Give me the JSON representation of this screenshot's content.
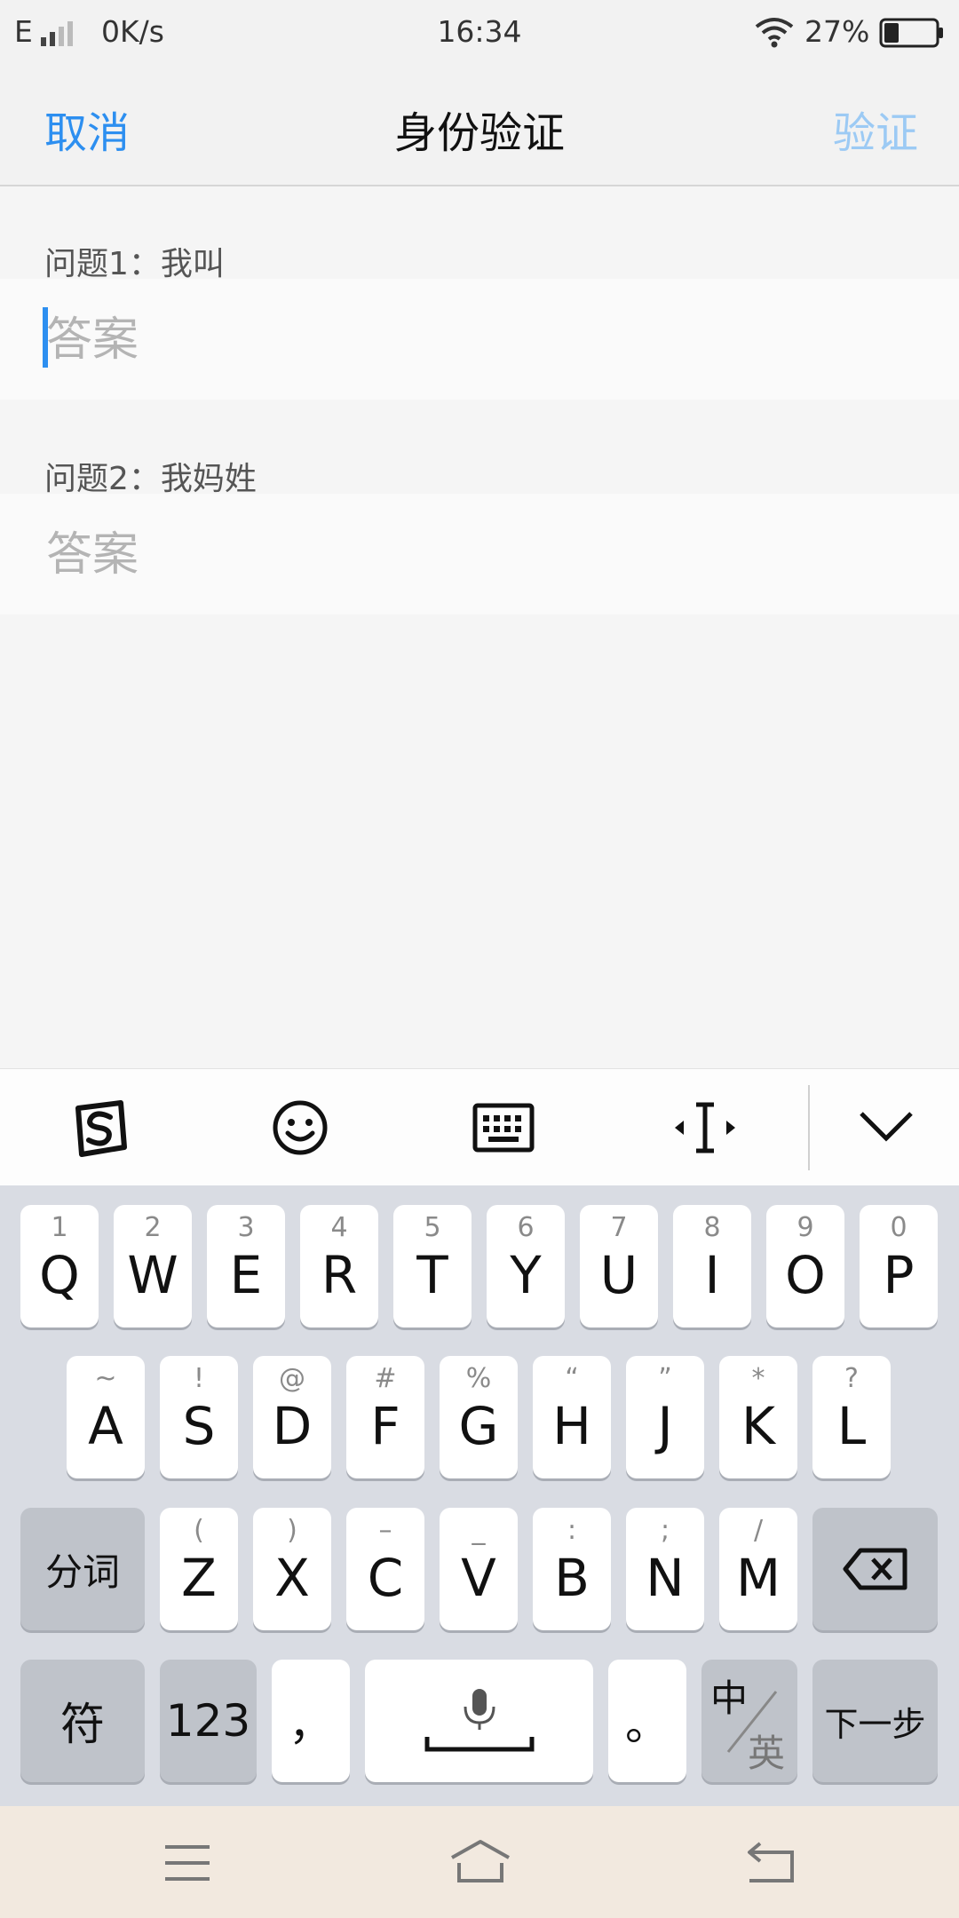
{
  "status_bar": {
    "network_type": "E",
    "speed": "0K/s",
    "time": "16:34",
    "battery_percent": "27%",
    "icons": [
      "signal-icon",
      "wifi-icon",
      "battery-icon"
    ]
  },
  "nav": {
    "cancel_label": "取消",
    "title": "身份验证",
    "verify_label": "验证"
  },
  "questions": [
    {
      "label": "问题1：我叫",
      "answer_value": "",
      "answer_placeholder": "答案"
    },
    {
      "label": "问题2：我妈姓",
      "answer_value": "",
      "answer_placeholder": "答案"
    }
  ],
  "keyboard_toolbar": {
    "icons": [
      "sogou-logo-icon",
      "emoji-icon",
      "keyboard-icon",
      "cursor-move-icon",
      "collapse-chevron-icon"
    ]
  },
  "keyboard": {
    "row1": [
      {
        "hint": "1",
        "key": "Q"
      },
      {
        "hint": "2",
        "key": "W"
      },
      {
        "hint": "3",
        "key": "E"
      },
      {
        "hint": "4",
        "key": "R"
      },
      {
        "hint": "5",
        "key": "T"
      },
      {
        "hint": "6",
        "key": "Y"
      },
      {
        "hint": "7",
        "key": "U"
      },
      {
        "hint": "8",
        "key": "I"
      },
      {
        "hint": "9",
        "key": "O"
      },
      {
        "hint": "0",
        "key": "P"
      }
    ],
    "row2": [
      {
        "hint": "~",
        "key": "A"
      },
      {
        "hint": "!",
        "key": "S"
      },
      {
        "hint": "@",
        "key": "D"
      },
      {
        "hint": "#",
        "key": "F"
      },
      {
        "hint": "%",
        "key": "G"
      },
      {
        "hint": "“",
        "key": "H"
      },
      {
        "hint": "”",
        "key": "J"
      },
      {
        "hint": "*",
        "key": "K"
      },
      {
        "hint": "?",
        "key": "L"
      }
    ],
    "row3": [
      {
        "hint": "(",
        "key": "Z"
      },
      {
        "hint": ")",
        "key": "X"
      },
      {
        "hint": "–",
        "key": "C"
      },
      {
        "hint": "_",
        "key": "V"
      },
      {
        "hint": ":",
        "key": "B"
      },
      {
        "hint": ";",
        "key": "N"
      },
      {
        "hint": "/",
        "key": "M"
      }
    ],
    "segment_label": "分词",
    "symbol_label": "符",
    "numbers_label": "123",
    "comma_label": "，",
    "period_label": "。",
    "lang_primary": "中",
    "lang_secondary": "英",
    "next_label": "下一步"
  },
  "system_nav": {
    "icons": [
      "menu-icon",
      "home-icon",
      "back-icon"
    ]
  }
}
